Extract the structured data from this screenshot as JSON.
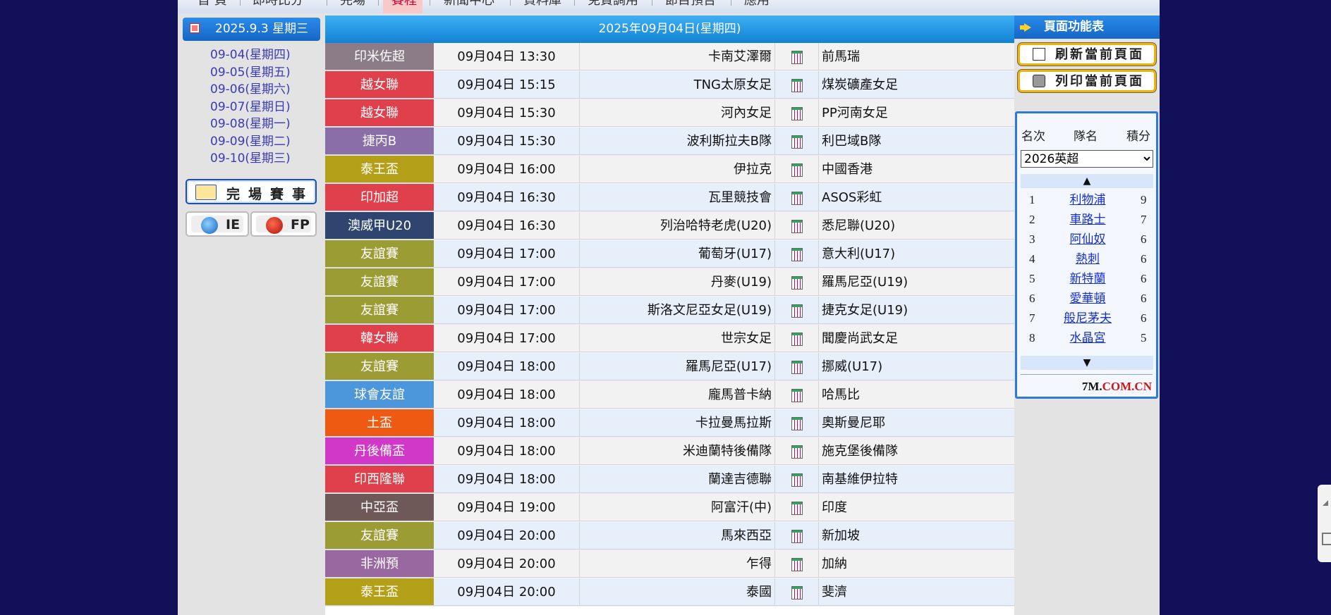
{
  "top_nav": [
    "首 頁",
    "即時比分",
    "完場",
    "賽程",
    "新聞中心",
    "資料庫",
    "免費調用",
    "節目預告",
    "應用"
  ],
  "left": {
    "date_header": "2025.9.3 星期三",
    "dates": [
      "09-04(星期四)",
      "09-05(星期五)",
      "09-06(星期六)",
      "09-07(星期日)",
      "09-08(星期一)",
      "09-09(星期二)",
      "09-10(星期三)"
    ],
    "finished_button": "完場賽事",
    "browser_buttons": [
      {
        "label": "IE",
        "icon": "ie-icon"
      },
      {
        "label": "FP",
        "icon": "firefox-icon"
      }
    ]
  },
  "schedule": {
    "date_title": "2025年09月04日(星期四)",
    "matches": [
      {
        "league": "印米佐超",
        "color": "#8c7c88",
        "time": "09月04日 13:30",
        "home": "卡南艾澤爾",
        "away": "前馬瑞"
      },
      {
        "league": "越女聯",
        "color": "#e0404c",
        "time": "09月04日 15:15",
        "home": "TNG太原女足",
        "away": "煤炭礦產女足"
      },
      {
        "league": "越女聯",
        "color": "#e0404c",
        "time": "09月04日 15:30",
        "home": "河內女足",
        "away": "PP河南女足"
      },
      {
        "league": "捷丙B",
        "color": "#8a6ea8",
        "time": "09月04日 15:30",
        "home": "波利斯拉夫B隊",
        "away": "利巴域B隊"
      },
      {
        "league": "泰王盃",
        "color": "#b3a018",
        "time": "09月04日 16:00",
        "home": "伊拉克",
        "away": "中國香港"
      },
      {
        "league": "印加超",
        "color": "#e0404c",
        "time": "09月04日 16:30",
        "home": "瓦里競技會",
        "away": "ASOS彩虹"
      },
      {
        "league": "澳威甲U20",
        "color": "#2f4570",
        "time": "09月04日 16:30",
        "home": "列治哈特老虎(U20)",
        "away": "悉尼聯(U20)"
      },
      {
        "league": "友誼賽",
        "color": "#9c9c34",
        "time": "09月04日 17:00",
        "home": "葡萄牙(U17)",
        "away": "意大利(U17)"
      },
      {
        "league": "友誼賽",
        "color": "#9c9c34",
        "time": "09月04日 17:00",
        "home": "丹麥(U19)",
        "away": "羅馬尼亞(U19)"
      },
      {
        "league": "友誼賽",
        "color": "#9c9c34",
        "time": "09月04日 17:00",
        "home": "斯洛文尼亞女足(U19)",
        "away": "捷克女足(U19)"
      },
      {
        "league": "韓女聯",
        "color": "#e0404c",
        "time": "09月04日 17:00",
        "home": "世宗女足",
        "away": "聞慶尚武女足"
      },
      {
        "league": "友誼賽",
        "color": "#9c9c34",
        "time": "09月04日 18:00",
        "home": "羅馬尼亞(U17)",
        "away": "挪威(U17)"
      },
      {
        "league": "球會友誼",
        "color": "#4c96dc",
        "time": "09月04日 18:00",
        "home": "龐馬普卡納",
        "away": "哈馬比"
      },
      {
        "league": "土盃",
        "color": "#ee5a12",
        "time": "09月04日 18:00",
        "home": "卡拉曼馬拉斯",
        "away": "奧斯曼尼耶"
      },
      {
        "league": "丹後備盃",
        "color": "#d238c8",
        "time": "09月04日 18:00",
        "home": "米迪蘭特後備隊",
        "away": "施克堡後備隊"
      },
      {
        "league": "印西隆聯",
        "color": "#e0404c",
        "time": "09月04日 18:00",
        "home": "蘭達吉德聯",
        "away": "南基維伊拉特"
      },
      {
        "league": "中亞盃",
        "color": "#6e5858",
        "time": "09月04日 19:00",
        "home": "阿富汗(中)",
        "away": "印度"
      },
      {
        "league": "友誼賽",
        "color": "#9c9c34",
        "time": "09月04日 20:00",
        "home": "馬來西亞",
        "away": "新加坡"
      },
      {
        "league": "非洲預",
        "color": "#9a68a0",
        "time": "09月04日 20:00",
        "home": "乍得",
        "away": "加納"
      },
      {
        "league": "泰王盃",
        "color": "#b3a018",
        "time": "09月04日 20:00",
        "home": "泰國",
        "away": "斐濟"
      }
    ]
  },
  "right": {
    "func_title": "頁面功能表",
    "refresh_button": "刷新當前頁面",
    "print_button": "列印當前頁面",
    "standings": {
      "col_rank": "名次",
      "col_team": "隊名",
      "col_points": "積分",
      "selected_league": "2026英超",
      "up_arrow": "▲",
      "down_arrow": "▼",
      "rows": [
        {
          "rank": "1",
          "team": "利物浦",
          "points": "9"
        },
        {
          "rank": "2",
          "team": "車路士",
          "points": "7"
        },
        {
          "rank": "3",
          "team": "阿仙奴",
          "points": "6"
        },
        {
          "rank": "4",
          "team": "熱刺",
          "points": "6"
        },
        {
          "rank": "5",
          "team": "新特蘭",
          "points": "6"
        },
        {
          "rank": "6",
          "team": "愛華頓",
          "points": "6"
        },
        {
          "rank": "7",
          "team": "般尼茅夫",
          "points": "6"
        },
        {
          "rank": "8",
          "team": "水晶宮",
          "points": "5"
        }
      ],
      "brand_a": "7M.",
      "brand_b": "COM.CN"
    }
  }
}
